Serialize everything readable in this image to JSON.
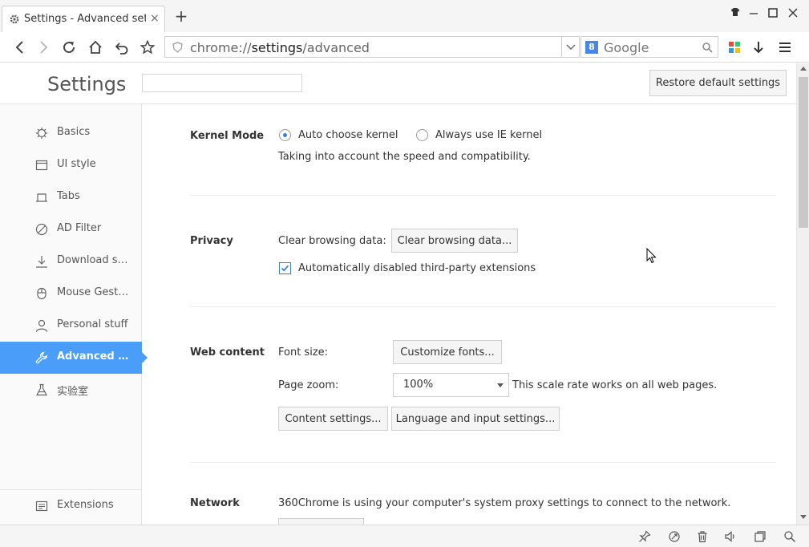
{
  "window": {
    "tab_title": "Settings - Advanced settin",
    "new_tab_label": "+"
  },
  "toolbar": {
    "address_scheme": "chrome://",
    "address_host": "settings",
    "address_path": "/advanced",
    "search_placeholder": "Google",
    "search_engine_badge": "8"
  },
  "page": {
    "title": "Settings",
    "restore_button": "Restore default settings"
  },
  "sidebar": {
    "items": [
      {
        "label": "Basics",
        "icon": "gear-icon"
      },
      {
        "label": "UI style",
        "icon": "window-icon"
      },
      {
        "label": "Tabs",
        "icon": "tab-icon"
      },
      {
        "label": "AD Filter",
        "icon": "block-icon"
      },
      {
        "label": "Download settings",
        "icon": "download-icon"
      },
      {
        "label": "Mouse Gesture",
        "icon": "mouse-icon"
      },
      {
        "label": "Personal stuff",
        "icon": "person-icon"
      },
      {
        "label": "Advanced settings",
        "icon": "wrench-icon",
        "active": true
      },
      {
        "label": "实验室",
        "icon": "flask-icon"
      }
    ],
    "extensions_label": "Extensions"
  },
  "sections": {
    "kernel": {
      "title": "Kernel Mode",
      "option_auto": "Auto choose kernel",
      "option_ie": "Always use IE kernel",
      "selected": "auto",
      "note": "Taking into account the speed and compatibility."
    },
    "privacy": {
      "title": "Privacy",
      "clear_label": "Clear browsing data:",
      "clear_button": "Clear browsing data...",
      "extensions_checkbox": "Automatically disabled third-party extensions",
      "extensions_checked": true
    },
    "web_content": {
      "title": "Web content",
      "font_label": "Font size:",
      "font_button": "Customize fonts...",
      "zoom_label": "Page zoom:",
      "zoom_value": "100%",
      "zoom_note": "This scale rate works on all web pages.",
      "content_button": "Content settings...",
      "language_button": "Language and input settings..."
    },
    "network": {
      "title": "Network",
      "note": "360Chrome is using your computer's system proxy settings to connect to the network."
    }
  },
  "colors": {
    "accent": "#4a9df8",
    "check": "#3a7fd6"
  }
}
